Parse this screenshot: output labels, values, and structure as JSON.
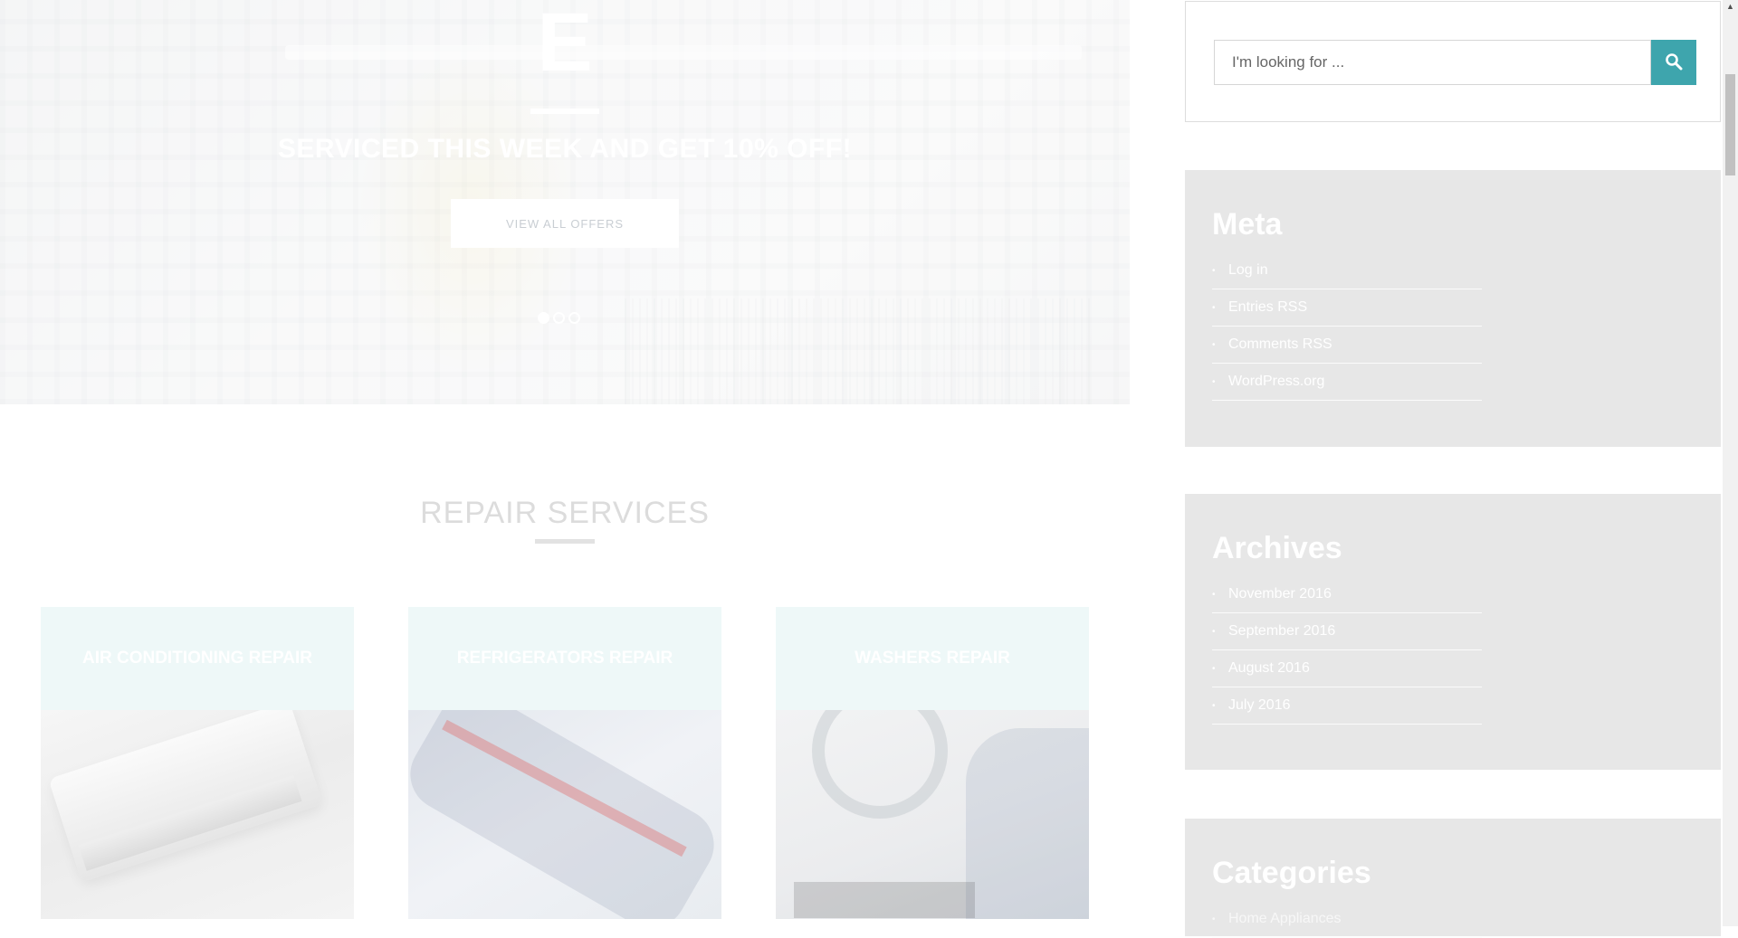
{
  "hero": {
    "letter": "E",
    "headline": "SERVICED THIS WEEK AND GET 10% OFF!",
    "button_label": "VIEW ALL OFFERS",
    "slides": [
      {
        "active": true
      },
      {
        "active": false
      },
      {
        "active": false
      }
    ]
  },
  "services": {
    "title": "REPAIR SERVICES",
    "cards": [
      {
        "title": "AIR CONDITIONING REPAIR",
        "image": "air-conditioner"
      },
      {
        "title": "REFRIGERATORS REPAIR",
        "image": "refrigerator"
      },
      {
        "title": "WASHERS REPAIR",
        "image": "washing-machine"
      }
    ]
  },
  "sidebar": {
    "search": {
      "placeholder": "I'm looking for ...",
      "icon": "search-icon"
    },
    "meta": {
      "title": "Meta",
      "items": [
        "Log in",
        "Entries RSS",
        "Comments RSS",
        "WordPress.org"
      ]
    },
    "archives": {
      "title": "Archives",
      "items": [
        "November 2016",
        "September 2016",
        "August 2016",
        "July 2016"
      ]
    },
    "categories": {
      "title": "Categories",
      "items": [
        "Home Appliances"
      ]
    }
  },
  "colors": {
    "accent": "#3ea5ad",
    "widget_bg": "#e7e7e7",
    "card_header_bg": "#eef8f8"
  }
}
